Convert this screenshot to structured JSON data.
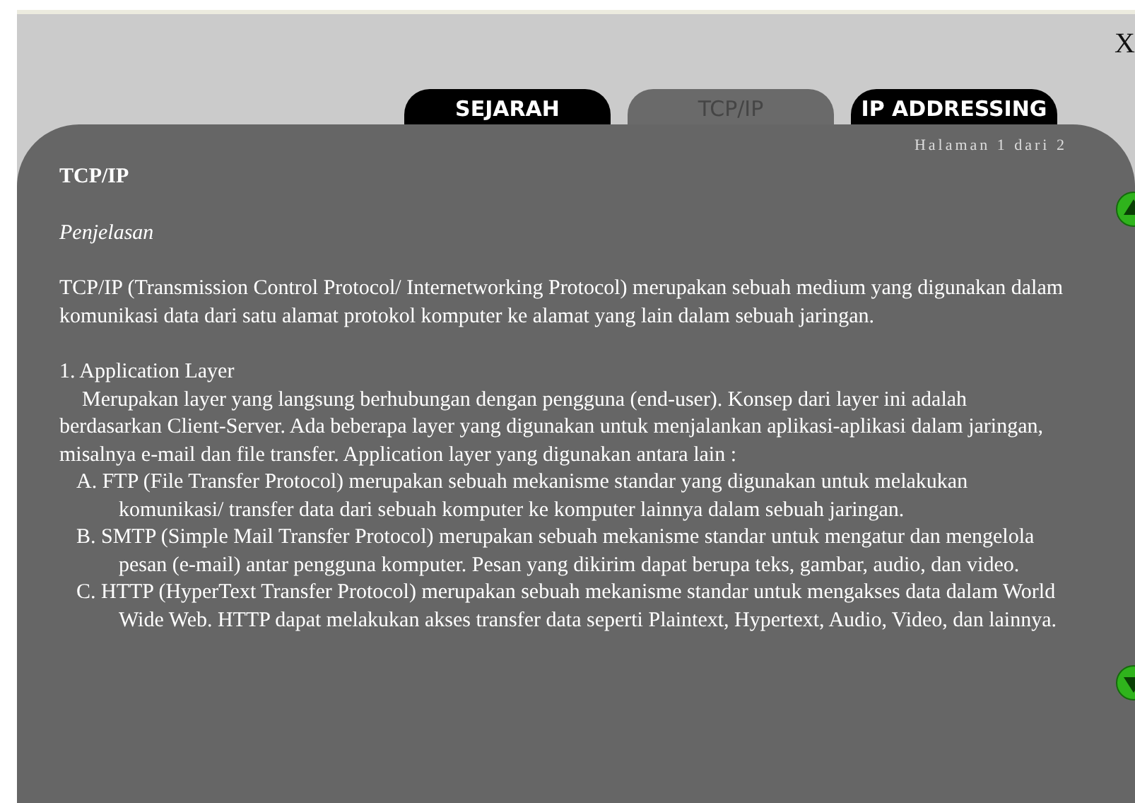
{
  "close_label": "X",
  "tabs": [
    {
      "label": "SEJARAH",
      "selected": false
    },
    {
      "label": "TCP/IP",
      "selected": true
    },
    {
      "label": "IP ADDRESSING",
      "selected": false
    }
  ],
  "page_indicator": "Halaman 1 dari 2",
  "heading": "TCP/IP",
  "subheading": "Penjelasan",
  "intro": "TCP/IP (Transmission Control Protocol/ Internetworking Protocol) merupakan sebuah medium yang digunakan dalam komunikasi data dari satu alamat protokol komputer ke alamat yang lain dalam sebuah jaringan.",
  "section_title": "1. Application Layer",
  "section_text": "Merupakan layer yang langsung berhubungan dengan pengguna (end-user). Konsep dari layer ini adalah berdasarkan Client-Server. Ada beberapa layer yang digunakan untuk menjalankan aplikasi-aplikasi dalam jaringan, misalnya e-mail dan file transfer. Application layer yang digunakan antara lain :",
  "items": [
    {
      "text": "A. FTP (File Transfer Protocol) merupakan sebuah mekanisme standar yang digunakan untuk melakukan komunikasi/ transfer data dari sebuah komputer ke komputer lainnya dalam sebuah jaringan."
    },
    {
      "text": "B. SMTP (Simple Mail Transfer Protocol) merupakan sebuah mekanisme standar untuk mengatur dan mengelola pesan (e-mail) antar pengguna komputer. Pesan yang dikirim dapat berupa teks, gambar, audio, dan video."
    },
    {
      "text": "C. HTTP (HyperText Transfer Protocol) merupakan sebuah mekanisme standar untuk mengakses data dalam World Wide Web. HTTP dapat melakukan akses transfer data seperti Plaintext, Hypertext, Audio, Video, dan lainnya."
    }
  ]
}
